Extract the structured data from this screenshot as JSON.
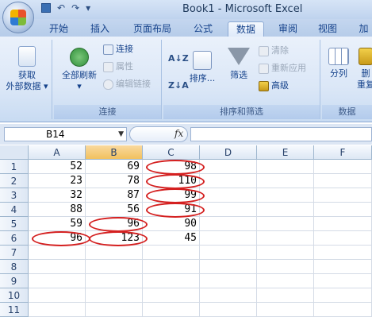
{
  "window": {
    "title": "Book1 - Microsoft Excel"
  },
  "quick_access": {
    "undo_glyph": "↶",
    "redo_glyph": "↷",
    "customize_glyph": "▾"
  },
  "tabs": [
    {
      "label": "开始"
    },
    {
      "label": "插入"
    },
    {
      "label": "页面布局"
    },
    {
      "label": "公式"
    },
    {
      "label": "数据",
      "active": true
    },
    {
      "label": "审阅"
    },
    {
      "label": "视图"
    },
    {
      "label": "加"
    }
  ],
  "ribbon": {
    "get_external": {
      "line1": "获取",
      "line2": "外部数据 ▾"
    },
    "connections": {
      "refresh_all": "全部刷新",
      "connections": "连接",
      "properties": "属性",
      "edit_links": "编辑链接",
      "group_label": "连接"
    },
    "sort_filter": {
      "sort": "排序...",
      "filter": "筛选",
      "clear": "清除",
      "reapply": "重新应用",
      "advanced": "高级",
      "group_label": "排序和筛选"
    },
    "data_tools": {
      "split": "分列",
      "remove_dup_1": "删",
      "remove_dup_2": "重复",
      "group_label": "数据"
    }
  },
  "formula_bar": {
    "name_box": "B14",
    "fx": "fx"
  },
  "grid": {
    "columns": [
      "A",
      "B",
      "C",
      "D",
      "E",
      "F"
    ],
    "rows": [
      "1",
      "2",
      "3",
      "4",
      "5",
      "6",
      "7",
      "8",
      "9",
      "10",
      "11"
    ],
    "data": [
      [
        "52",
        "69",
        "98"
      ],
      [
        "23",
        "78",
        "110"
      ],
      [
        "32",
        "87",
        "99"
      ],
      [
        "88",
        "56",
        "91"
      ],
      [
        "59",
        "96",
        "90"
      ],
      [
        "96",
        "123",
        "45"
      ]
    ],
    "highlighted": [
      "C1",
      "C2",
      "C3",
      "C4",
      "B5",
      "A6",
      "B6"
    ],
    "highlight_color": "#d42020",
    "selected_column": "B"
  }
}
